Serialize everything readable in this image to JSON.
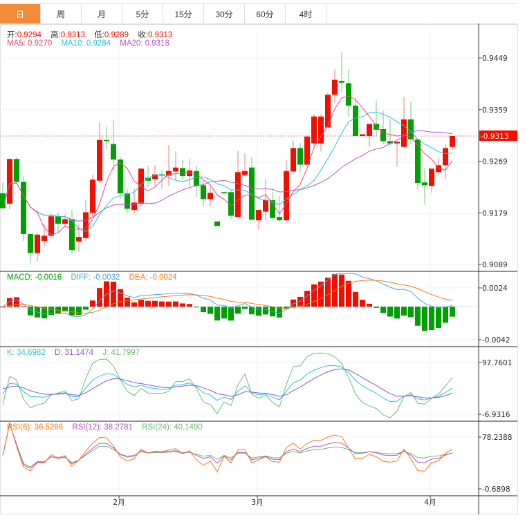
{
  "tabs": [
    {
      "label": "日",
      "active": true
    },
    {
      "label": "周"
    },
    {
      "label": "月"
    },
    {
      "label": "5分"
    },
    {
      "label": "15分"
    },
    {
      "label": "30分"
    },
    {
      "label": "60分"
    },
    {
      "label": "4时"
    }
  ],
  "ohlc": {
    "open_label": "开:",
    "open": "0.9294",
    "high_label": "高:",
    "high": "0.9313",
    "low_label": "低:",
    "low": "0.9289",
    "close_label": "收:",
    "close": "0.9313"
  },
  "ma": {
    "ma5": "MA5: 0.9270",
    "ma10": "MA10: 0.9284",
    "ma20": "MA20: 0.9318"
  },
  "macd": {
    "macd": "MACD: -0.0016",
    "diff": "DIFF: -0.0032",
    "dea": "DEA: -0.0024"
  },
  "kdj": {
    "k": "K: 34.6982",
    "d": "D: 31.1474",
    "j": "J: 41.7997"
  },
  "rsi": {
    "r6": "RSI(6): 36.5266",
    "r12": "RSI(12): 38.2781",
    "r24": "RSI(24): 40.1490"
  },
  "axes": {
    "price_ticks": [
      "0.9449",
      "0.9359",
      "0.9269",
      "0.9179",
      "0.9089"
    ],
    "price_range": [
      0.9089,
      0.9449
    ],
    "last_price": "0.9313",
    "macd_ticks": [
      "0.0024",
      "-0.0042"
    ],
    "macd_range": [
      -0.0042,
      0.0024
    ],
    "kdj_ticks": [
      "97.7601",
      "-6.9316"
    ],
    "kdj_range": [
      -6.9316,
      97.7601
    ],
    "rsi_ticks": [
      "78.2388",
      "-0.6898"
    ],
    "rsi_range": [
      -0.6898,
      78.2388
    ],
    "months": [
      {
        "label": "2月",
        "index": 16.8
      },
      {
        "label": "3月",
        "index": 36.8
      },
      {
        "label": "4月",
        "index": 61.8
      }
    ]
  },
  "colors": {
    "up": "#f20f00",
    "down": "#00a000",
    "ma5": "#f0457e",
    "ma10": "#27c3da",
    "ma20": "#b455c8",
    "diff": "#4aa3ee",
    "dea": "#f57a1c",
    "k": "#27c3da",
    "d": "#8a55d0",
    "j": "#6cbd6c",
    "r6": "#f57a1c",
    "r12": "#b455c8",
    "r24": "#6cbd6c"
  },
  "candles": [
    [
      0.9213,
      0.9232,
      0.9186,
      0.9187
    ],
    [
      0.9195,
      0.9275,
      0.9185,
      0.9273
    ],
    [
      0.9273,
      0.9277,
      0.9231,
      0.9233
    ],
    [
      0.9233,
      0.9243,
      0.913,
      0.9142
    ],
    [
      0.9142,
      0.9144,
      0.9091,
      0.9109
    ],
    [
      0.9109,
      0.9144,
      0.9094,
      0.9141
    ],
    [
      0.913,
      0.9159,
      0.912,
      0.9139
    ],
    [
      0.9139,
      0.9178,
      0.9136,
      0.9173
    ],
    [
      0.9173,
      0.918,
      0.9145,
      0.916
    ],
    [
      0.916,
      0.9176,
      0.9154,
      0.9168
    ],
    [
      0.9168,
      0.9184,
      0.9108,
      0.9114
    ],
    [
      0.9129,
      0.9159,
      0.9111,
      0.9137
    ],
    [
      0.9135,
      0.9202,
      0.913,
      0.918
    ],
    [
      0.9179,
      0.9246,
      0.9172,
      0.9237
    ],
    [
      0.9235,
      0.9337,
      0.9231,
      0.9306
    ],
    [
      0.9306,
      0.9329,
      0.929,
      0.9304
    ],
    [
      0.9299,
      0.9342,
      0.9251,
      0.9272
    ],
    [
      0.9272,
      0.9276,
      0.9204,
      0.9213
    ],
    [
      0.9213,
      0.9221,
      0.9178,
      0.9186
    ],
    [
      0.9184,
      0.9221,
      0.9177,
      0.9197
    ],
    [
      0.9195,
      0.9258,
      0.9189,
      0.9256
    ],
    [
      0.924,
      0.9261,
      0.9225,
      0.9235
    ],
    [
      0.9238,
      0.9262,
      0.9226,
      0.9246
    ],
    [
      0.9246,
      0.9254,
      0.9221,
      0.9244
    ],
    [
      0.9244,
      0.9297,
      0.9226,
      0.9252
    ],
    [
      0.9251,
      0.9286,
      0.9235,
      0.9258
    ],
    [
      0.9257,
      0.9271,
      0.9238,
      0.9243
    ],
    [
      0.9243,
      0.9273,
      0.9226,
      0.9253
    ],
    [
      0.9252,
      0.9261,
      0.9207,
      0.9226
    ],
    [
      0.9227,
      0.9235,
      0.919,
      0.9203
    ],
    [
      0.9203,
      0.9226,
      0.9191,
      0.9214
    ],
    [
      0.9164,
      0.9164,
      0.9156,
      0.9156
    ],
    [
      0.9215,
      0.9216,
      0.9212,
      0.9213
    ],
    [
      0.9215,
      0.922,
      0.9168,
      0.9174
    ],
    [
      0.9172,
      0.9287,
      0.9171,
      0.925
    ],
    [
      0.9245,
      0.9283,
      0.9243,
      0.9252
    ],
    [
      0.9258,
      0.9276,
      0.9166,
      0.9167
    ],
    [
      0.9166,
      0.9184,
      0.915,
      0.9184
    ],
    [
      0.9181,
      0.9238,
      0.9166,
      0.9201
    ],
    [
      0.9201,
      0.9216,
      0.9168,
      0.917
    ],
    [
      0.9172,
      0.9208,
      0.9163,
      0.9166
    ],
    [
      0.9166,
      0.9272,
      0.9162,
      0.9252
    ],
    [
      0.9251,
      0.9305,
      0.9247,
      0.9292
    ],
    [
      0.9292,
      0.9301,
      0.925,
      0.9263
    ],
    [
      0.9263,
      0.9314,
      0.9262,
      0.9312
    ],
    [
      0.93,
      0.9351,
      0.9295,
      0.9347
    ],
    [
      0.93,
      0.9351,
      0.9286,
      0.9347
    ],
    [
      0.9328,
      0.9388,
      0.9327,
      0.9385
    ],
    [
      0.9385,
      0.943,
      0.9371,
      0.9411
    ],
    [
      0.9409,
      0.946,
      0.9389,
      0.9406
    ],
    [
      0.9405,
      0.9429,
      0.9346,
      0.9366
    ],
    [
      0.9366,
      0.938,
      0.9313,
      0.9313
    ],
    [
      0.9313,
      0.9316,
      0.9313,
      0.9316
    ],
    [
      0.9313,
      0.9334,
      0.9294,
      0.9334
    ],
    [
      0.9334,
      0.9375,
      0.9313,
      0.9324
    ],
    [
      0.9325,
      0.9357,
      0.9298,
      0.9304
    ],
    [
      0.9304,
      0.9342,
      0.9295,
      0.93
    ],
    [
      0.93,
      0.9303,
      0.9259,
      0.9303
    ],
    [
      0.9294,
      0.9381,
      0.9294,
      0.9342
    ],
    [
      0.9342,
      0.9372,
      0.9298,
      0.9307
    ],
    [
      0.9307,
      0.9307,
      0.922,
      0.9231
    ],
    [
      0.9232,
      0.9258,
      0.9193,
      0.9227
    ],
    [
      0.9226,
      0.9256,
      0.9214,
      0.9256
    ],
    [
      0.925,
      0.9274,
      0.9243,
      0.9262
    ],
    [
      0.9262,
      0.9298,
      0.9238,
      0.9292
    ],
    [
      0.9294,
      0.9313,
      0.9289,
      0.9313
    ]
  ]
}
